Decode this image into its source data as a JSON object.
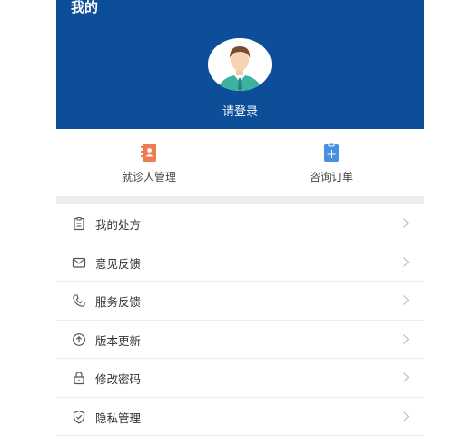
{
  "header": {
    "title": "我的",
    "login_text": "请登录"
  },
  "quick": [
    {
      "label": "就诊人管理",
      "icon": "patient-management-icon",
      "color": "#f07b50"
    },
    {
      "label": "咨询订单",
      "icon": "consult-order-icon",
      "color": "#4a90e2"
    }
  ],
  "menu": [
    {
      "label": "我的处方",
      "icon": "prescription-icon"
    },
    {
      "label": "意见反馈",
      "icon": "mail-icon"
    },
    {
      "label": "服务反馈",
      "icon": "phone-icon"
    },
    {
      "label": "版本更新",
      "icon": "upload-icon"
    },
    {
      "label": "修改密码",
      "icon": "lock-icon"
    },
    {
      "label": "隐私管理",
      "icon": "shield-icon"
    }
  ],
  "colors": {
    "header_bg": "#0d4e98",
    "divider": "#eeeeee"
  }
}
